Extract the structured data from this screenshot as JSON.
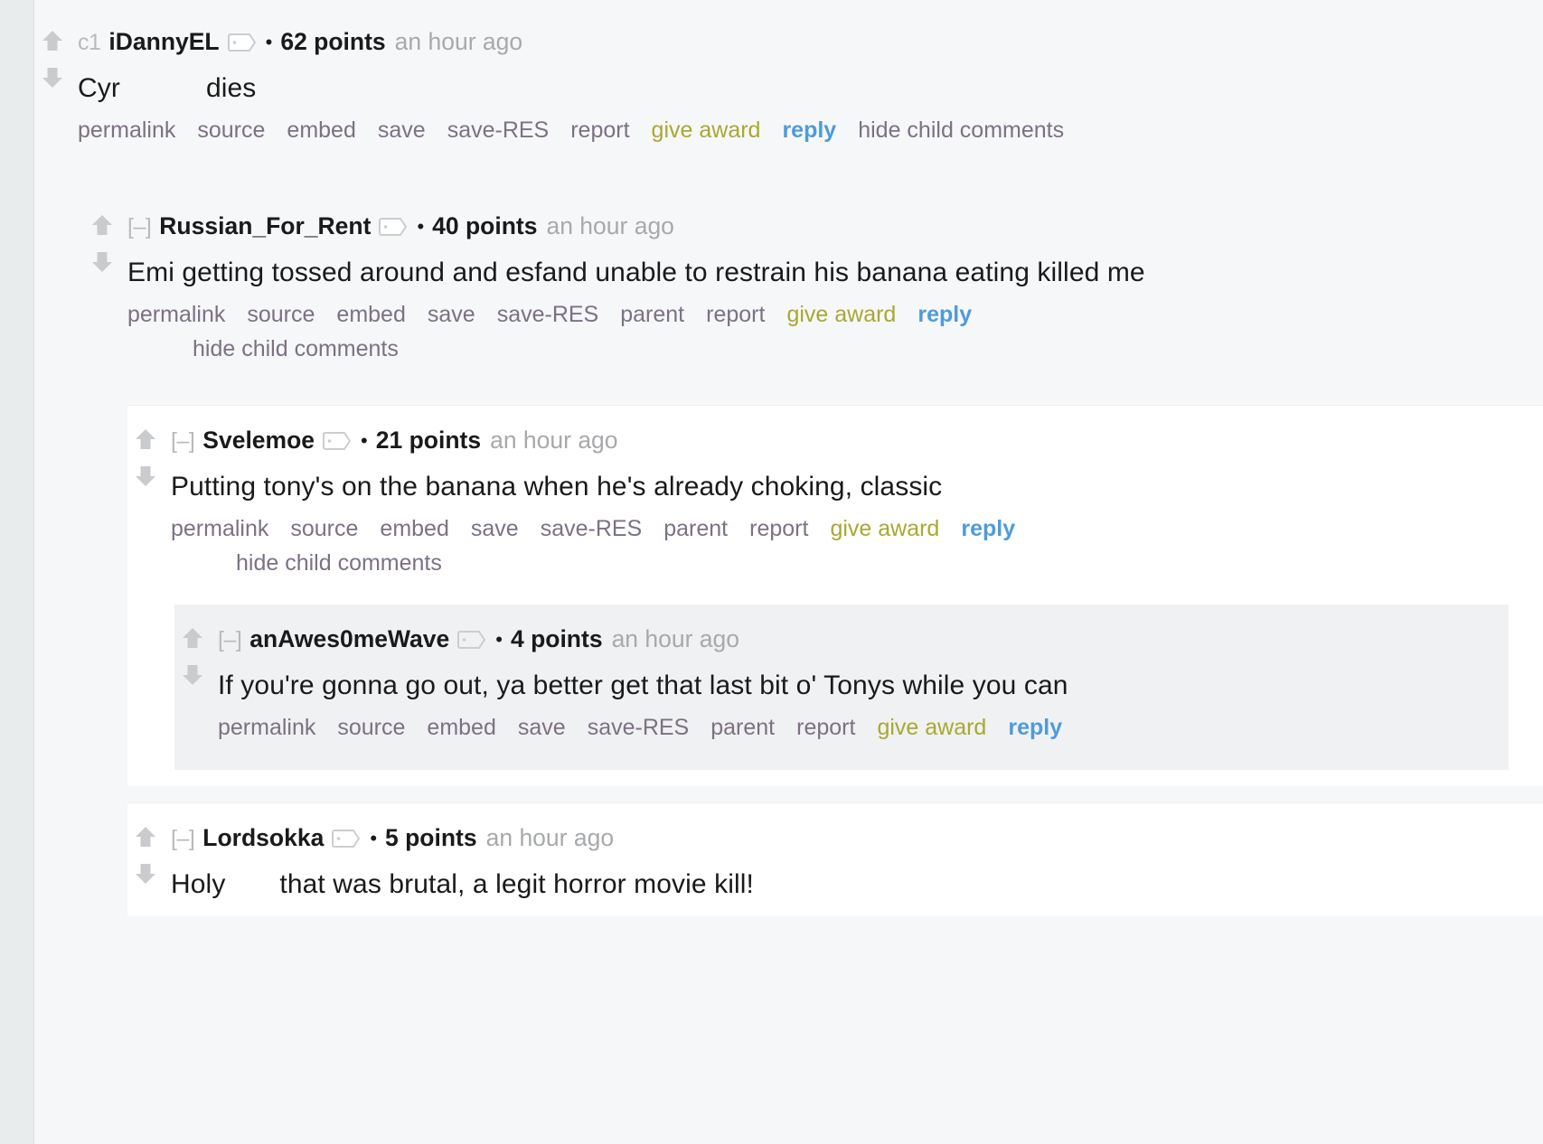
{
  "theme": {
    "page_bg": "#ffffff",
    "thread_bg": "#f6f7f8",
    "gutter_bg": "#e9eced",
    "text": "#1a1a1b",
    "muted": "#888a8c",
    "age": "#a7a9ab",
    "action_link": "#7c7184",
    "award_link": "#a9a832",
    "reply_link": "#4f9bd9",
    "nested_white": "#ffffff",
    "nested_gray": "#f0f1f2"
  },
  "icons": {
    "upvote": "upvote-arrow-icon",
    "downvote": "downvote-arrow-icon",
    "collapse": "collapse-toggle-icon",
    "flair": "user-flair-tag-icon"
  },
  "labels": {
    "collapse": "[–]",
    "bullet": "•",
    "permalink": "permalink",
    "source": "source",
    "embed": "embed",
    "save": "save",
    "save_res": "save-RES",
    "parent": "parent",
    "report": "report",
    "give_award": "give award",
    "reply": "reply",
    "hide_child_comments": "hide child comments"
  },
  "comments": [
    {
      "id": "c1",
      "depth": 0,
      "author": "iDannyEL",
      "points": "62 points",
      "age": "an hour ago",
      "text_before": "Cyr",
      "text_after": "dies",
      "has_gap": true,
      "actions": [
        "permalink",
        "source",
        "embed",
        "save",
        "save-RES",
        "report",
        "give award",
        "reply",
        "hide child comments"
      ]
    },
    {
      "id": "c2",
      "depth": 1,
      "author": "Russian_For_Rent",
      "points": "40 points",
      "age": "an hour ago",
      "text": "Emi getting tossed around and esfand unable to restrain his banana eating killed me",
      "has_gap": false,
      "actions": [
        "permalink",
        "source",
        "embed",
        "save",
        "save-RES",
        "parent",
        "report",
        "give award",
        "reply",
        "hide child comments"
      ]
    },
    {
      "id": "c3",
      "depth": 2,
      "author": "Svelemoe",
      "points": "21 points",
      "age": "an hour ago",
      "text": "Putting tony's on the banana when he's already choking, classic",
      "has_gap": false,
      "actions": [
        "permalink",
        "source",
        "embed",
        "save",
        "save-RES",
        "parent",
        "report",
        "give award",
        "reply",
        "hide child comments"
      ]
    },
    {
      "id": "c4",
      "depth": 3,
      "author": "anAwes0meWave",
      "points": "4 points",
      "age": "an hour ago",
      "text": "If you're gonna go out, ya better get that last bit o' Tonys while you can",
      "has_gap": false,
      "actions": [
        "permalink",
        "source",
        "embed",
        "save",
        "save-RES",
        "parent",
        "report",
        "give award",
        "reply"
      ]
    },
    {
      "id": "c5",
      "depth": 2,
      "author": "Lordsokka",
      "points": "5 points",
      "age": "an hour ago",
      "text_before": "Holy",
      "text_after": "that was brutal, a legit horror movie kill!",
      "has_gap": true,
      "actions": []
    }
  ]
}
